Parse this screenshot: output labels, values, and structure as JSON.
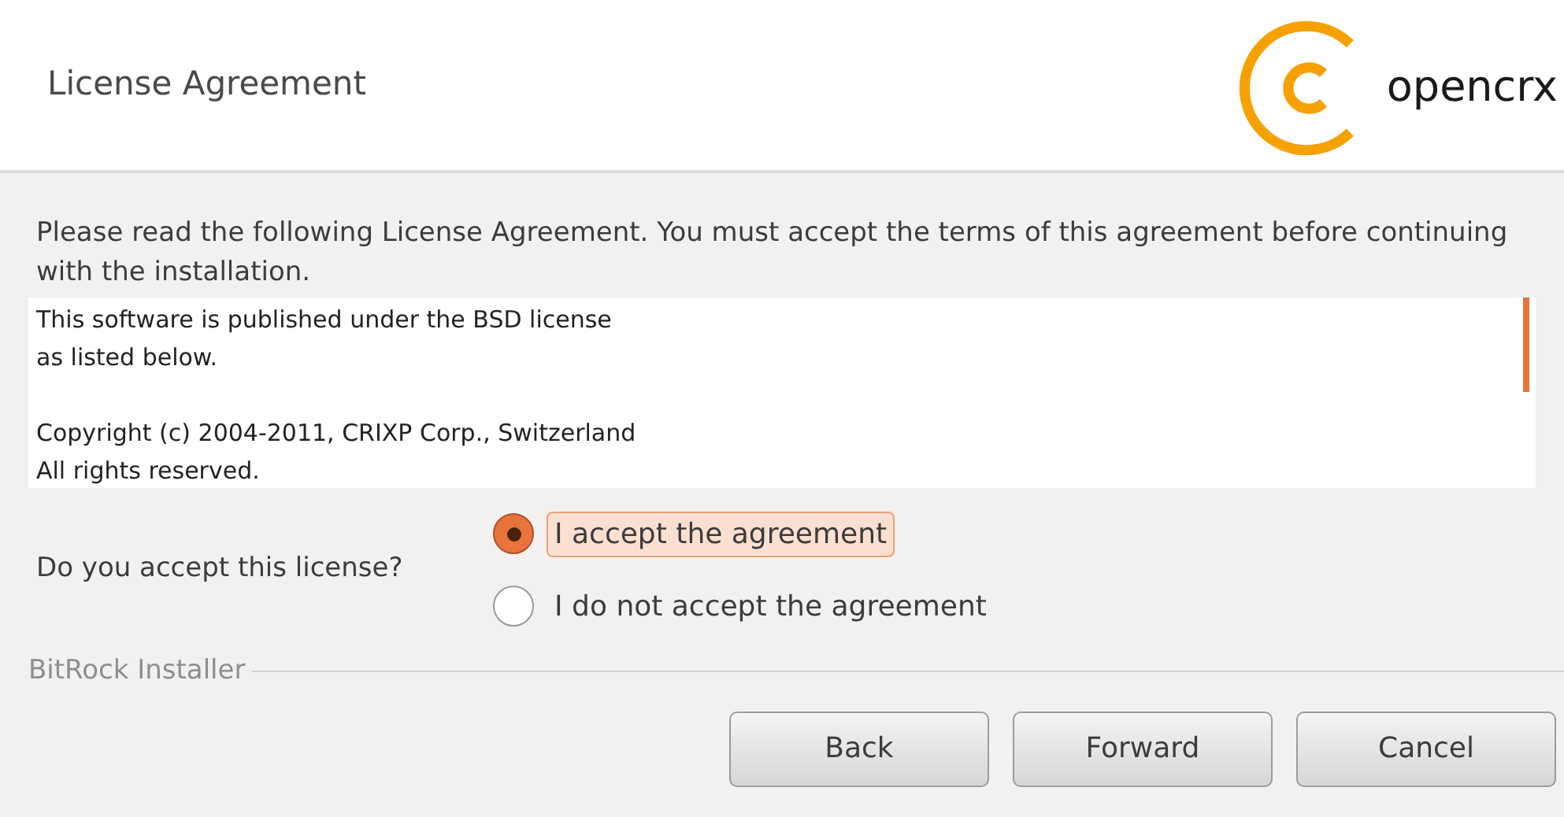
{
  "header": {
    "title": "License Agreement",
    "logo_text": "opencrx"
  },
  "intro": "Please read the following License Agreement. You must accept the terms of this agreement before continuing with the installation.",
  "license_paragraphs": [
    [
      "This software is published under the BSD license",
      "as listed below."
    ],
    [
      "Copyright (c) 2004-2011, CRIXP Corp., Switzerland",
      "All rights reserved."
    ]
  ],
  "question": "Do you accept this license?",
  "options": [
    {
      "label": "I accept the agreement",
      "selected": true
    },
    {
      "label": "I do not accept the agreement",
      "selected": false
    }
  ],
  "footer_label": "BitRock Installer",
  "buttons": [
    "Back",
    "Forward",
    "Cancel"
  ]
}
